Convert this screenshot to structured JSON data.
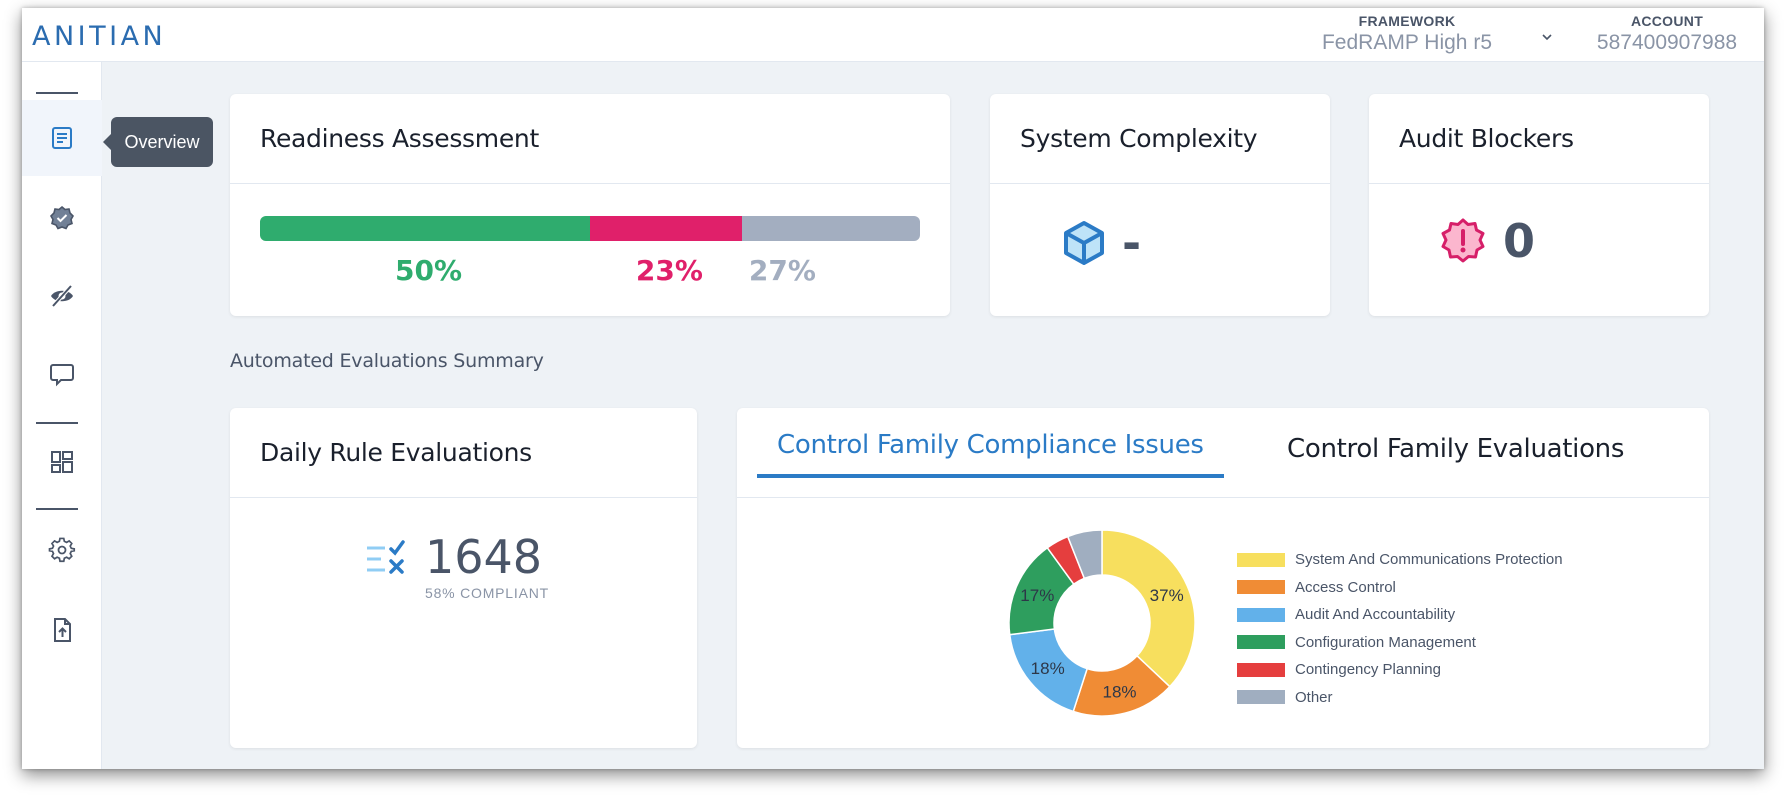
{
  "app": {
    "logo_text": "ANITIAN",
    "brand_color": "#2b6cb0"
  },
  "header": {
    "framework": {
      "label": "FRAMEWORK",
      "value": "FedRAMP High r5"
    },
    "account": {
      "label": "ACCOUNT",
      "value": "587400907988"
    }
  },
  "sidebar": {
    "items": [
      {
        "name": "overview",
        "icon": "document-icon",
        "active": true
      },
      {
        "name": "compliance",
        "icon": "badge-check-icon",
        "active": false
      },
      {
        "name": "hidden",
        "icon": "eye-off-icon",
        "active": false
      },
      {
        "name": "comments",
        "icon": "chat-icon",
        "active": false
      },
      {
        "name": "dashboard",
        "icon": "dashboard-icon",
        "active": false
      },
      {
        "name": "settings",
        "icon": "gear-icon",
        "active": false
      },
      {
        "name": "upload",
        "icon": "file-upload-icon",
        "active": false
      }
    ],
    "tooltip": "Overview"
  },
  "readiness": {
    "title": "Readiness Assessment",
    "segments": [
      {
        "label": "50%",
        "value": 50,
        "color": "#2fac6e"
      },
      {
        "label": "23%",
        "value": 23,
        "color": "#e0206a"
      },
      {
        "label": "27%",
        "value": 27,
        "color": "#a3aec0"
      }
    ]
  },
  "complexity": {
    "title": "System Complexity",
    "value": "-",
    "icon": "cube-icon"
  },
  "blockers": {
    "title": "Audit Blockers",
    "value": "0",
    "icon": "alert-badge-icon"
  },
  "section_label": "Automated Evaluations Summary",
  "daily": {
    "title": "Daily Rule Evaluations",
    "value": "1648",
    "subtitle": "58% COMPLIANT",
    "icon": "list-check-x-icon"
  },
  "family": {
    "tabs": [
      {
        "label": "Control Family Compliance Issues",
        "active": true
      },
      {
        "label": "Control Family Evaluations",
        "active": false
      }
    ]
  },
  "chart_data": {
    "type": "pie",
    "subtype": "donut",
    "title": "Control Family Compliance Issues",
    "legend_position": "right",
    "series": [
      {
        "name": "System And Communications Protection",
        "value": 37,
        "label": "37%",
        "color": "#f7df5e"
      },
      {
        "name": "Access Control",
        "value": 18,
        "label": "18%",
        "color": "#f08c35"
      },
      {
        "name": "Audit And Accountability",
        "value": 18,
        "label": "18%",
        "color": "#62b1ea"
      },
      {
        "name": "Configuration Management",
        "value": 17,
        "label": "17%",
        "color": "#2e9e5e"
      },
      {
        "name": "Contingency Planning",
        "value": 4,
        "label": "",
        "color": "#e53e3e"
      },
      {
        "name": "Other",
        "value": 6,
        "label": "",
        "color": "#a0aec0"
      }
    ]
  }
}
